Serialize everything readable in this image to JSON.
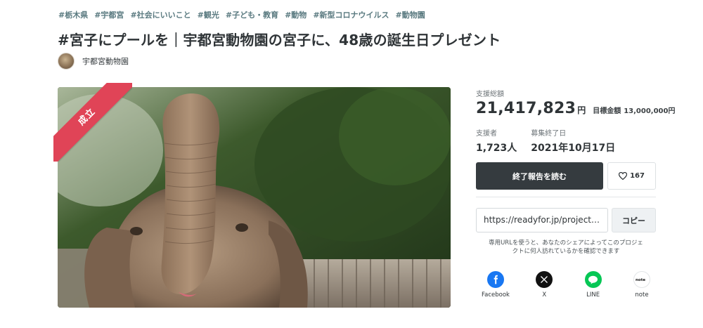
{
  "tags": [
    "#栃木県",
    "#宇都宮",
    "#社会にいいこと",
    "#観光",
    "#子ども・教育",
    "#動物",
    "#新型コロナウイルス",
    "#動物園"
  ],
  "title": "#宮子にプールを｜宇都宮動物園の宮子に、48歳の誕生日プレゼント",
  "owner": {
    "name": "宇都宮動物園"
  },
  "hero": {
    "badge": "成立",
    "badge_color": "#e04457"
  },
  "stats": {
    "total_label": "支援総額",
    "total": "21,417,823",
    "total_unit": "円",
    "goal_label": "目標金額",
    "goal": "13,000,000円",
    "supporters_label": "支援者",
    "supporters": "1,723人",
    "end_label": "募集終了日",
    "end_date": "2021年10月17日"
  },
  "actions": {
    "report_label": "終了報告を読む",
    "like_count": "167"
  },
  "share_url": {
    "value": "https://readyfor.jp/projects/...",
    "copy_label": "コピー",
    "note_line1": "専用URLを使うと、あなたのシェアによってこのプロジェ",
    "note_line2": "クトに何人訪れているかを確認できます"
  },
  "share": [
    {
      "name": "Facebook",
      "icon": "facebook-icon",
      "color": "#1877f2"
    },
    {
      "name": "X",
      "icon": "x-icon",
      "color": "#111111"
    },
    {
      "name": "LINE",
      "icon": "line-icon",
      "color": "#06c755"
    },
    {
      "name": "note",
      "icon": "note-icon",
      "color": "#ffffff"
    }
  ]
}
